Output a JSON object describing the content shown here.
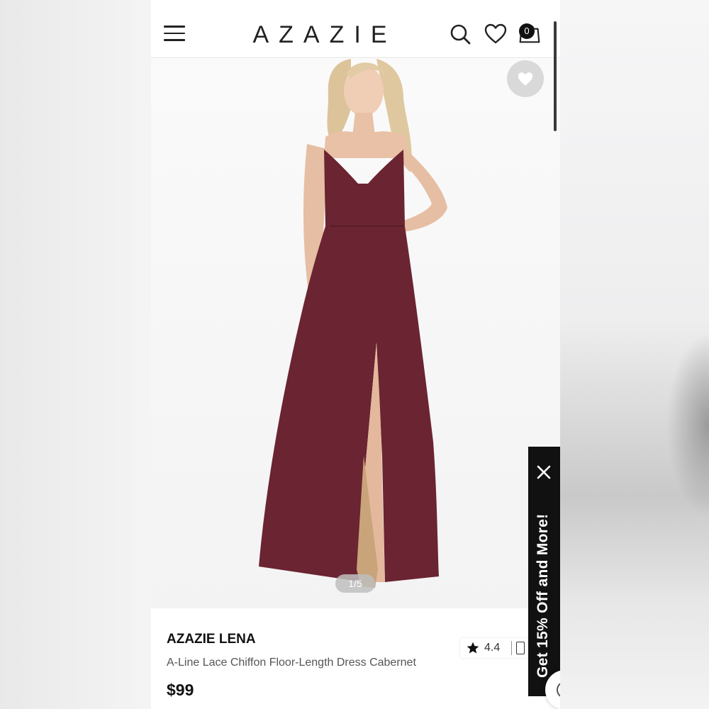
{
  "header": {
    "logo": "AZAZIE",
    "bag_count": "0"
  },
  "gallery": {
    "counter": "1/5"
  },
  "product": {
    "brand": "AZAZIE LENA",
    "title": "A-Line Lace Chiffon Floor-Length Dress Cabernet",
    "price": "$99",
    "rating": "4.4",
    "dress_color": "#6b2431"
  },
  "promo": {
    "text": "Get 15% Off and More!"
  },
  "colors": {
    "accent": "#111111",
    "background": "#ffffff"
  }
}
